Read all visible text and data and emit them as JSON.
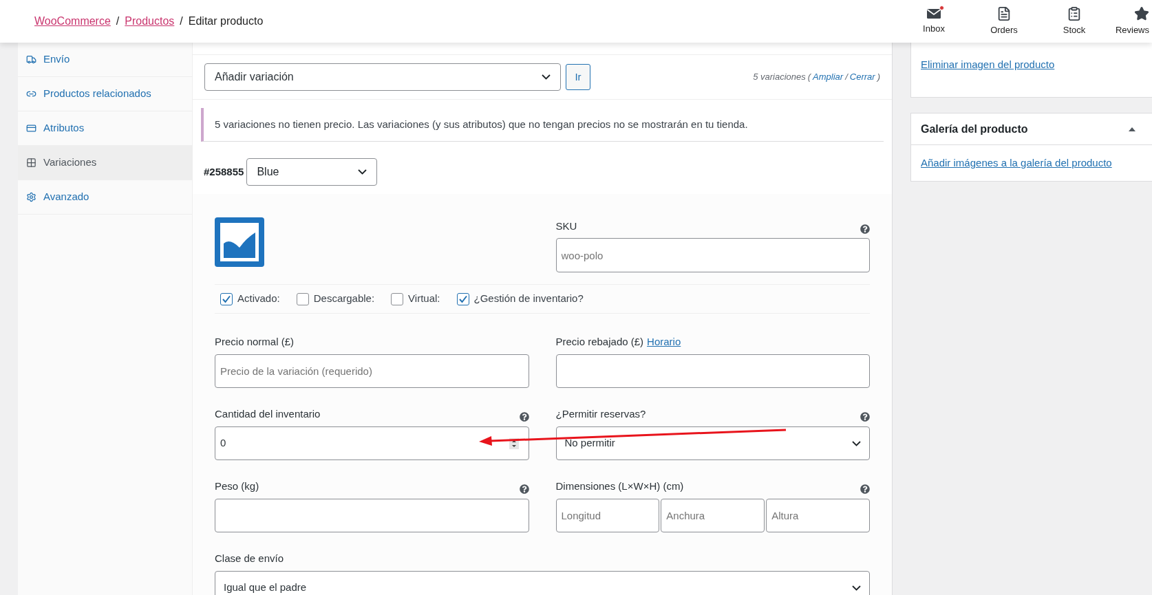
{
  "breadcrumb": [
    {
      "label": "WooCommerce",
      "kind": "link"
    },
    {
      "label": "/",
      "kind": "separator"
    },
    {
      "label": "Productos",
      "kind": "link"
    },
    {
      "label": "/",
      "kind": "separator"
    },
    {
      "label": "Editar producto",
      "kind": "current"
    }
  ],
  "activity": [
    {
      "label": "Inbox",
      "notification": true
    },
    {
      "label": "Orders",
      "notification": false
    },
    {
      "label": "Stock",
      "notification": false
    },
    {
      "label": "Reviews",
      "notification": false
    }
  ],
  "sidebar": {
    "items": [
      {
        "label": "Envío",
        "selected": false
      },
      {
        "label": "Productos relacionados",
        "selected": false
      },
      {
        "label": "Atributos",
        "selected": false
      },
      {
        "label": "Variaciones",
        "selected": true
      },
      {
        "label": "Avanzado",
        "selected": false
      }
    ]
  },
  "toolbar": {
    "action": "Añadir variación",
    "go_button": "Ir",
    "summary": {
      "count": "5 variaciones",
      "open": "(",
      "links": [
        "Ampliar",
        "Cerrar"
      ],
      "separator": "/",
      "close": ")"
    }
  },
  "notice": "5 variaciones no tienen precio. Las variaciones (y sus atributos) que no tengan precios no se mostrarán en tu tienda.",
  "variation": {
    "id": "#258855",
    "attribute": "Blue",
    "sku": {
      "label": "SKU",
      "placeholder": "woo-polo",
      "help": true
    },
    "options": [
      {
        "label": "Activado:",
        "checked": true
      },
      {
        "label": "Descargable:",
        "checked": false
      },
      {
        "label": "Virtual:",
        "checked": false
      },
      {
        "label": "¿Gestión de inventario?",
        "checked": true
      }
    ],
    "fields": [
      {
        "kind": "text",
        "label": "Precio normal (£)",
        "placeholder": "Precio de la variación (requerido)",
        "help": false,
        "wide": false
      },
      {
        "kind": "text",
        "label": "Precio rebajado (£)",
        "link": "Horario",
        "help": false,
        "wide": false
      },
      {
        "kind": "number",
        "label": "Cantidad del inventario",
        "value": "0",
        "help": true,
        "wide": false
      },
      {
        "kind": "select",
        "label": "¿Permitir reservas?",
        "value": "No permitir",
        "help": true,
        "wide": false
      },
      {
        "kind": "text",
        "label": "Peso (kg)",
        "help": true,
        "wide": false
      },
      {
        "kind": "dimensions",
        "label": "Dimensiones (L×W×H) (cm)",
        "placeholders": [
          "Longitud",
          "Anchura",
          "Altura"
        ],
        "help": true,
        "wide": false
      },
      {
        "kind": "select",
        "label": "Clase de envío",
        "value": "Igual que el padre",
        "help": false,
        "wide": true
      }
    ]
  },
  "side_cards": [
    {
      "link": "Eliminar imagen del producto"
    },
    {
      "title": "Galería del producto",
      "expanded": true,
      "link": "Añadir imágenes a la galería del producto"
    }
  ]
}
